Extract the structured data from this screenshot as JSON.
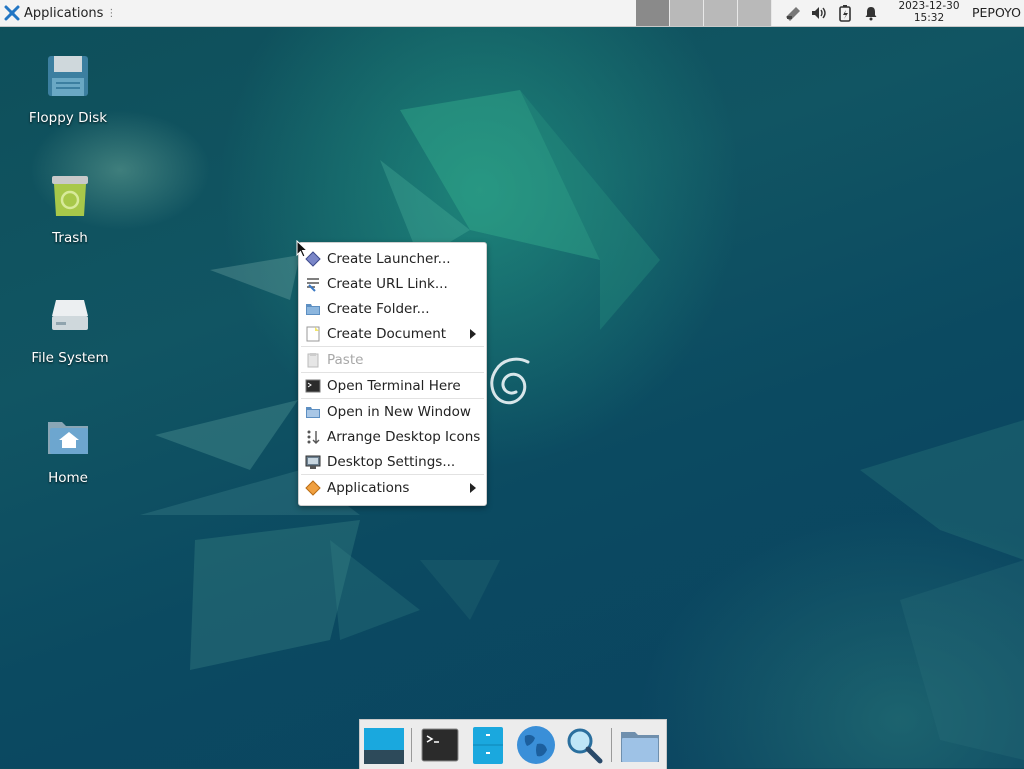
{
  "panel": {
    "apps_label": "Applications",
    "apps_separator": "⋮",
    "workspaces": 4,
    "clock_date": "2023-12-30",
    "clock_time": "15:32",
    "user": "PEPOYO",
    "tray_icons": [
      "network-icon",
      "volume-icon",
      "battery-icon",
      "notification-bell-icon"
    ]
  },
  "desktop_icons": [
    {
      "label": "Floppy Disk",
      "icon": "floppy-disk-icon"
    },
    {
      "label": "Trash",
      "icon": "trash-icon"
    },
    {
      "label": "File System",
      "icon": "drive-icon"
    },
    {
      "label": "Home",
      "icon": "home-folder-icon"
    }
  ],
  "context_menu": {
    "items": [
      {
        "label": "Create Launcher...",
        "icon": "launcher-icon"
      },
      {
        "label": "Create URL Link...",
        "icon": "url-link-icon"
      },
      {
        "label": "Create Folder...",
        "icon": "folder-icon"
      },
      {
        "label": "Create Document",
        "icon": "document-icon",
        "submenu": true
      },
      {
        "label": "Paste",
        "icon": "paste-icon",
        "disabled": true
      },
      {
        "label": "Open Terminal Here",
        "icon": "terminal-icon"
      },
      {
        "label": "Open in New Window",
        "icon": "window-icon"
      },
      {
        "label": "Arrange Desktop Icons",
        "icon": "arrange-icon"
      },
      {
        "label": "Desktop Settings...",
        "icon": "settings-icon"
      },
      {
        "label": "Applications",
        "icon": "applications-icon",
        "submenu": true
      }
    ]
  },
  "dock": [
    "show-desktop-icon",
    "terminal-icon",
    "file-manager-icon",
    "web-browser-icon",
    "search-icon",
    "folder-icon"
  ],
  "colors": {
    "desktop": "#0f4a5c",
    "panel": "#f3f3f3",
    "menu": "#ffffff",
    "accent": "#2aa3d6"
  }
}
